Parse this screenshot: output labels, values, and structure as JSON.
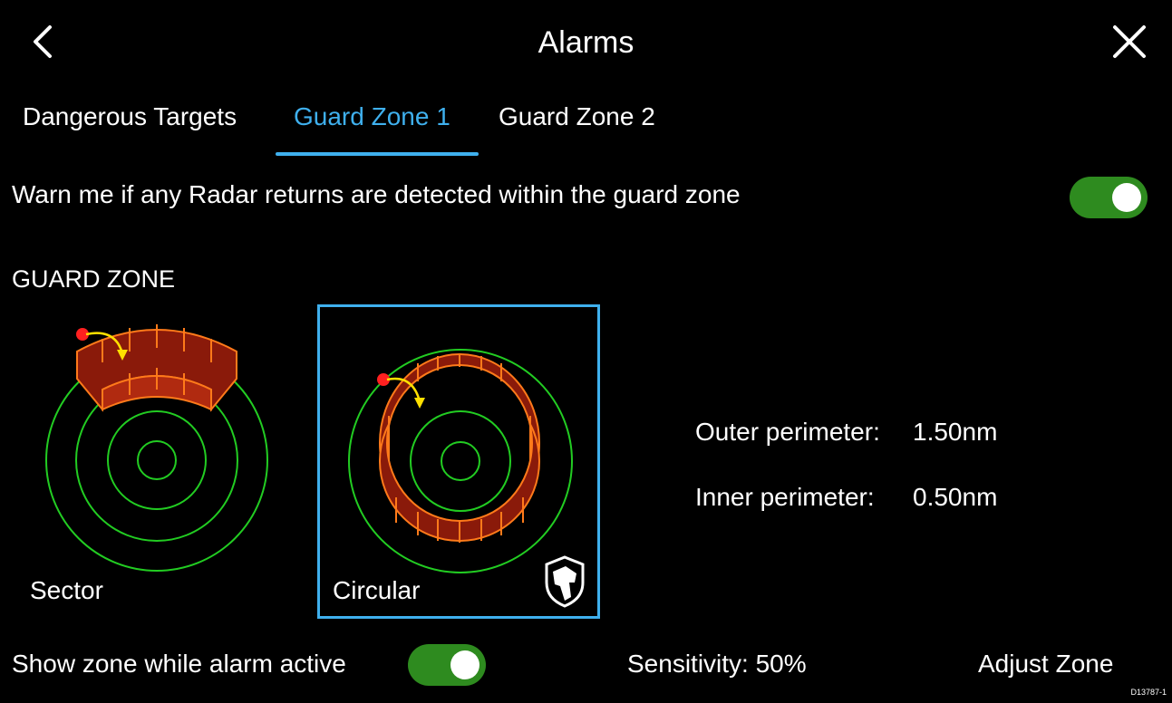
{
  "header": {
    "title": "Alarms",
    "back_icon": "chevron-left-icon",
    "close_icon": "close-icon"
  },
  "tabs": [
    {
      "label": "Dangerous Targets",
      "active": false
    },
    {
      "label": "Guard Zone 1",
      "active": true
    },
    {
      "label": "Guard Zone 2",
      "active": false
    }
  ],
  "warn": {
    "label": "Warn me if any Radar returns are detected within the guard zone",
    "enabled": true
  },
  "guard_zone": {
    "section_title": "GUARD ZONE",
    "options": [
      {
        "label": "Sector",
        "selected": false
      },
      {
        "label": "Circular",
        "selected": true
      }
    ],
    "badge_icon": "dog-shield-icon",
    "outer_label": "Outer perimeter:",
    "outer_value": "1.50nm",
    "inner_label": "Inner perimeter:",
    "inner_value": "0.50nm"
  },
  "bottom": {
    "show_zone_label": "Show zone while alarm active",
    "show_zone_enabled": true,
    "sensitivity": "Sensitivity: 50%",
    "adjust_label": "Adjust Zone"
  },
  "ref_code": "D13787-1",
  "colors": {
    "accent": "#3fb0ee",
    "toggle_on": "#2e8b1f",
    "radar_ring": "#22cc22",
    "zone_fill": "#8a1a0a",
    "zone_edge": "#ff7a1a",
    "marker": "#ff2020",
    "arrow": "#ffe000"
  }
}
